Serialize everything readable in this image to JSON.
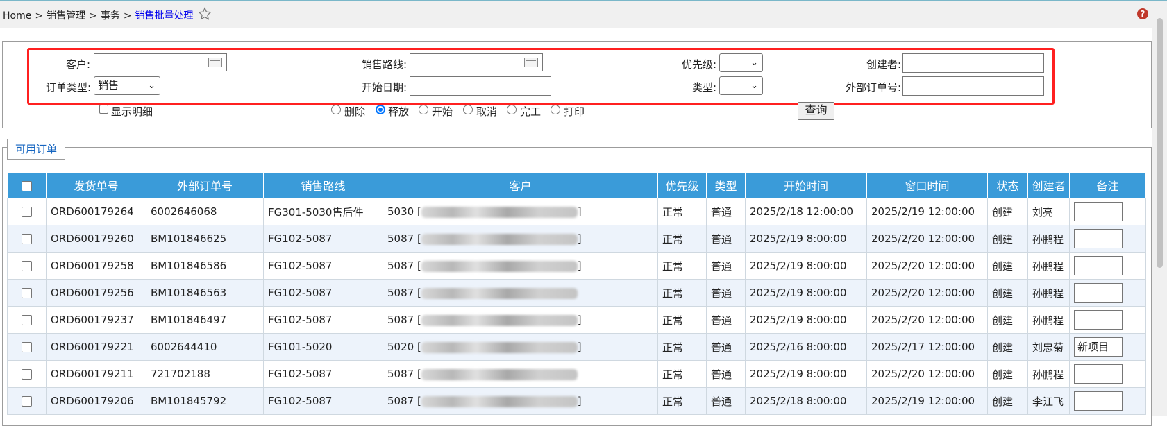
{
  "breadcrumb": {
    "home": "Home",
    "sep": ">",
    "level1": "销售管理",
    "level2": "事务",
    "current": "销售批量处理"
  },
  "help_icon": "?",
  "filters": {
    "customer_label": "客户:",
    "customer_value": "",
    "route_label": "销售路线:",
    "route_value": "",
    "priority_label": "优先级:",
    "priority_value": "",
    "creator_label": "创建者:",
    "creator_value": "",
    "order_type_label": "订单类型:",
    "order_type_value": "销售",
    "start_date_label": "开始日期:",
    "start_date_value": "",
    "type_label": "类型:",
    "type_value": "",
    "ext_order_label": "外部订单号:",
    "ext_order_value": "",
    "show_detail_label": "显示明细",
    "show_detail_checked": false,
    "actions": [
      {
        "label": "删除",
        "checked": false
      },
      {
        "label": "释放",
        "checked": true
      },
      {
        "label": "开始",
        "checked": false
      },
      {
        "label": "取消",
        "checked": false
      },
      {
        "label": "完工",
        "checked": false
      },
      {
        "label": "打印",
        "checked": false
      }
    ],
    "query_button": "查询"
  },
  "tab": "可用订单",
  "table": {
    "columns": [
      "发货单号",
      "外部订单号",
      "销售路线",
      "客户",
      "优先级",
      "类型",
      "开始时间",
      "窗口时间",
      "状态",
      "创建者",
      "备注"
    ],
    "rows": [
      {
        "ship": "ORD600179264",
        "ext": "6002646068",
        "route": "FG301-5030售后件",
        "cust_pre": "5030 [",
        "cust_post": "]",
        "prio": "正常",
        "type": "普通",
        "start": "2025/2/18 12:00:00",
        "window": "2025/2/19 12:00:00",
        "status": "创建",
        "creator": "刘亮",
        "note": ""
      },
      {
        "ship": "ORD600179260",
        "ext": "BM101846625",
        "route": "FG102-5087",
        "cust_pre": "5087 [",
        "cust_post": "]",
        "prio": "正常",
        "type": "普通",
        "start": "2025/2/19 8:00:00",
        "window": "2025/2/20 12:00:00",
        "status": "创建",
        "creator": "孙鹏程",
        "note": ""
      },
      {
        "ship": "ORD600179258",
        "ext": "BM101846586",
        "route": "FG102-5087",
        "cust_pre": "5087 [",
        "cust_post": "]",
        "prio": "正常",
        "type": "普通",
        "start": "2025/2/19 8:00:00",
        "window": "2025/2/20 12:00:00",
        "status": "创建",
        "creator": "孙鹏程",
        "note": ""
      },
      {
        "ship": "ORD600179256",
        "ext": "BM101846563",
        "route": "FG102-5087",
        "cust_pre": "5087 [",
        "cust_post": "",
        "prio": "正常",
        "type": "普通",
        "start": "2025/2/19 8:00:00",
        "window": "2025/2/20 12:00:00",
        "status": "创建",
        "creator": "孙鹏程",
        "note": ""
      },
      {
        "ship": "ORD600179237",
        "ext": "BM101846497",
        "route": "FG102-5087",
        "cust_pre": "5087 [",
        "cust_post": "]",
        "prio": "正常",
        "type": "普通",
        "start": "2025/2/19 8:00:00",
        "window": "2025/2/20 12:00:00",
        "status": "创建",
        "creator": "孙鹏程",
        "note": ""
      },
      {
        "ship": "ORD600179221",
        "ext": "6002644410",
        "route": "FG101-5020",
        "cust_pre": "5020 [",
        "cust_post": "]",
        "prio": "正常",
        "type": "普通",
        "start": "2025/2/16 8:00:00",
        "window": "2025/2/17 12:00:00",
        "status": "创建",
        "creator": "刘忠菊",
        "note": "新项目"
      },
      {
        "ship": "ORD600179211",
        "ext": "721702188",
        "route": "FG102-5087",
        "cust_pre": "5087 [",
        "cust_post": "",
        "prio": "正常",
        "type": "普通",
        "start": "2025/2/19 8:00:00",
        "window": "2025/2/20 12:00:00",
        "status": "创建",
        "creator": "孙鹏程",
        "note": ""
      },
      {
        "ship": "ORD600179206",
        "ext": "BM101845792",
        "route": "FG102-5087",
        "cust_pre": "5087 [",
        "cust_post": "]",
        "prio": "正常",
        "type": "普通",
        "start": "2025/2/18 8:00:00",
        "window": "2025/2/19 12:00:00",
        "status": "创建",
        "creator": "李江飞",
        "note": ""
      }
    ]
  }
}
